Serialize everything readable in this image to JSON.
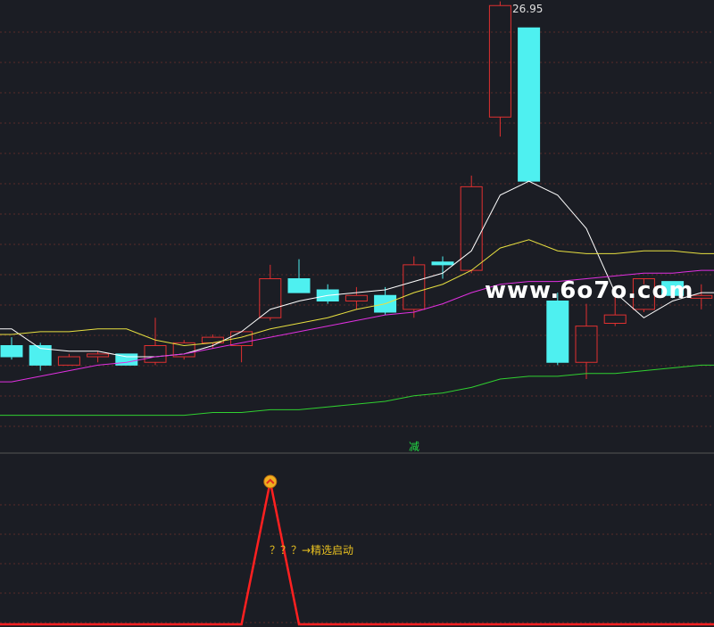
{
  "chart_data": {
    "type": "candlestick",
    "max_price_label": "26.95",
    "candles": [
      {
        "o": 14.6,
        "h": 14.9,
        "l": 14.1,
        "c": 14.2
      },
      {
        "o": 14.6,
        "h": 14.7,
        "l": 13.7,
        "c": 13.9
      },
      {
        "o": 13.9,
        "h": 14.3,
        "l": 13.9,
        "c": 14.2
      },
      {
        "o": 14.2,
        "h": 14.4,
        "l": 14.0,
        "c": 14.3
      },
      {
        "o": 14.3,
        "h": 14.3,
        "l": 13.9,
        "c": 13.9
      },
      {
        "o": 14.0,
        "h": 15.6,
        "l": 13.9,
        "c": 14.6
      },
      {
        "o": 14.2,
        "h": 14.8,
        "l": 14.1,
        "c": 14.7
      },
      {
        "o": 14.7,
        "h": 15.0,
        "l": 14.5,
        "c": 14.9
      },
      {
        "o": 14.6,
        "h": 15.1,
        "l": 14.0,
        "c": 15.1
      },
      {
        "o": 15.6,
        "h": 17.5,
        "l": 15.5,
        "c": 17.0
      },
      {
        "o": 17.0,
        "h": 17.7,
        "l": 16.5,
        "c": 16.5
      },
      {
        "o": 16.6,
        "h": 16.8,
        "l": 16.1,
        "c": 16.2
      },
      {
        "o": 16.2,
        "h": 16.7,
        "l": 15.9,
        "c": 16.4
      },
      {
        "o": 16.4,
        "h": 16.7,
        "l": 15.7,
        "c": 15.8
      },
      {
        "o": 15.9,
        "h": 17.8,
        "l": 15.6,
        "c": 17.5
      },
      {
        "o": 17.6,
        "h": 17.8,
        "l": 17.0,
        "c": 17.5
      },
      {
        "o": 17.3,
        "h": 20.7,
        "l": 17.2,
        "c": 20.3
      },
      {
        "o": 22.8,
        "h": 26.95,
        "l": 22.1,
        "c": 26.8
      },
      {
        "o": 26.0,
        "h": 26.0,
        "l": 20.5,
        "c": 20.5
      },
      {
        "o": 16.2,
        "h": 16.5,
        "l": 13.9,
        "c": 14.0
      },
      {
        "o": 14.0,
        "h": 16.1,
        "l": 13.4,
        "c": 15.3
      },
      {
        "o": 15.4,
        "h": 16.7,
        "l": 15.3,
        "c": 15.7
      },
      {
        "o": 15.9,
        "h": 16.8,
        "l": 15.8,
        "c": 17.0
      },
      {
        "o": 16.9,
        "h": 16.9,
        "l": 16.3,
        "c": 16.4
      },
      {
        "o": 16.3,
        "h": 16.8,
        "l": 15.9,
        "c": 16.4
      }
    ],
    "series": [
      {
        "color": "#ffffff",
        "values": [
          15.2,
          14.5,
          14.4,
          14.4,
          14.2,
          14.2,
          14.3,
          14.6,
          15.1,
          15.9,
          16.2,
          16.4,
          16.5,
          16.6,
          16.9,
          17.2,
          18.0,
          20.0,
          20.5,
          20.0,
          18.8,
          16.5,
          15.6,
          16.2,
          16.5
        ]
      },
      {
        "color": "#e8e040",
        "values": [
          15.0,
          15.1,
          15.1,
          15.2,
          15.2,
          14.8,
          14.6,
          14.7,
          14.9,
          15.2,
          15.4,
          15.6,
          15.9,
          16.1,
          16.5,
          16.8,
          17.3,
          18.1,
          18.4,
          18.0,
          17.9,
          17.9,
          18.0,
          18.0,
          17.9
        ]
      },
      {
        "color": "#e030e0",
        "values": [
          13.3,
          13.5,
          13.7,
          13.9,
          14.0,
          14.2,
          14.3,
          14.5,
          14.7,
          14.9,
          15.1,
          15.3,
          15.5,
          15.7,
          15.8,
          16.1,
          16.5,
          16.8,
          16.9,
          16.9,
          17.0,
          17.1,
          17.2,
          17.2,
          17.3
        ]
      },
      {
        "color": "#30d030",
        "values": [
          12.1,
          12.1,
          12.1,
          12.1,
          12.1,
          12.1,
          12.1,
          12.2,
          12.2,
          12.3,
          12.3,
          12.4,
          12.5,
          12.6,
          12.8,
          12.9,
          13.1,
          13.4,
          13.5,
          13.5,
          13.6,
          13.6,
          13.7,
          13.8,
          13.9
        ]
      }
    ],
    "indicator": {
      "color": "#ff2020",
      "values": [
        0,
        0,
        0,
        0,
        0,
        0,
        0,
        0,
        0,
        1,
        0,
        0,
        0,
        0,
        0,
        0,
        0,
        0,
        0,
        0,
        0,
        0,
        0,
        0,
        0
      ]
    },
    "main_ylim": [
      11.0,
      27.0
    ],
    "indicator_ylim": [
      0,
      1
    ],
    "colors": {
      "up": "#e03030",
      "down": "#4ef0f0",
      "background": "#1b1d24",
      "grid": "#5a2a2a"
    }
  },
  "labels": {
    "separator": "减",
    "indicator_note": "？？？→精选启动",
    "watermark": "www.6o7o.com"
  }
}
